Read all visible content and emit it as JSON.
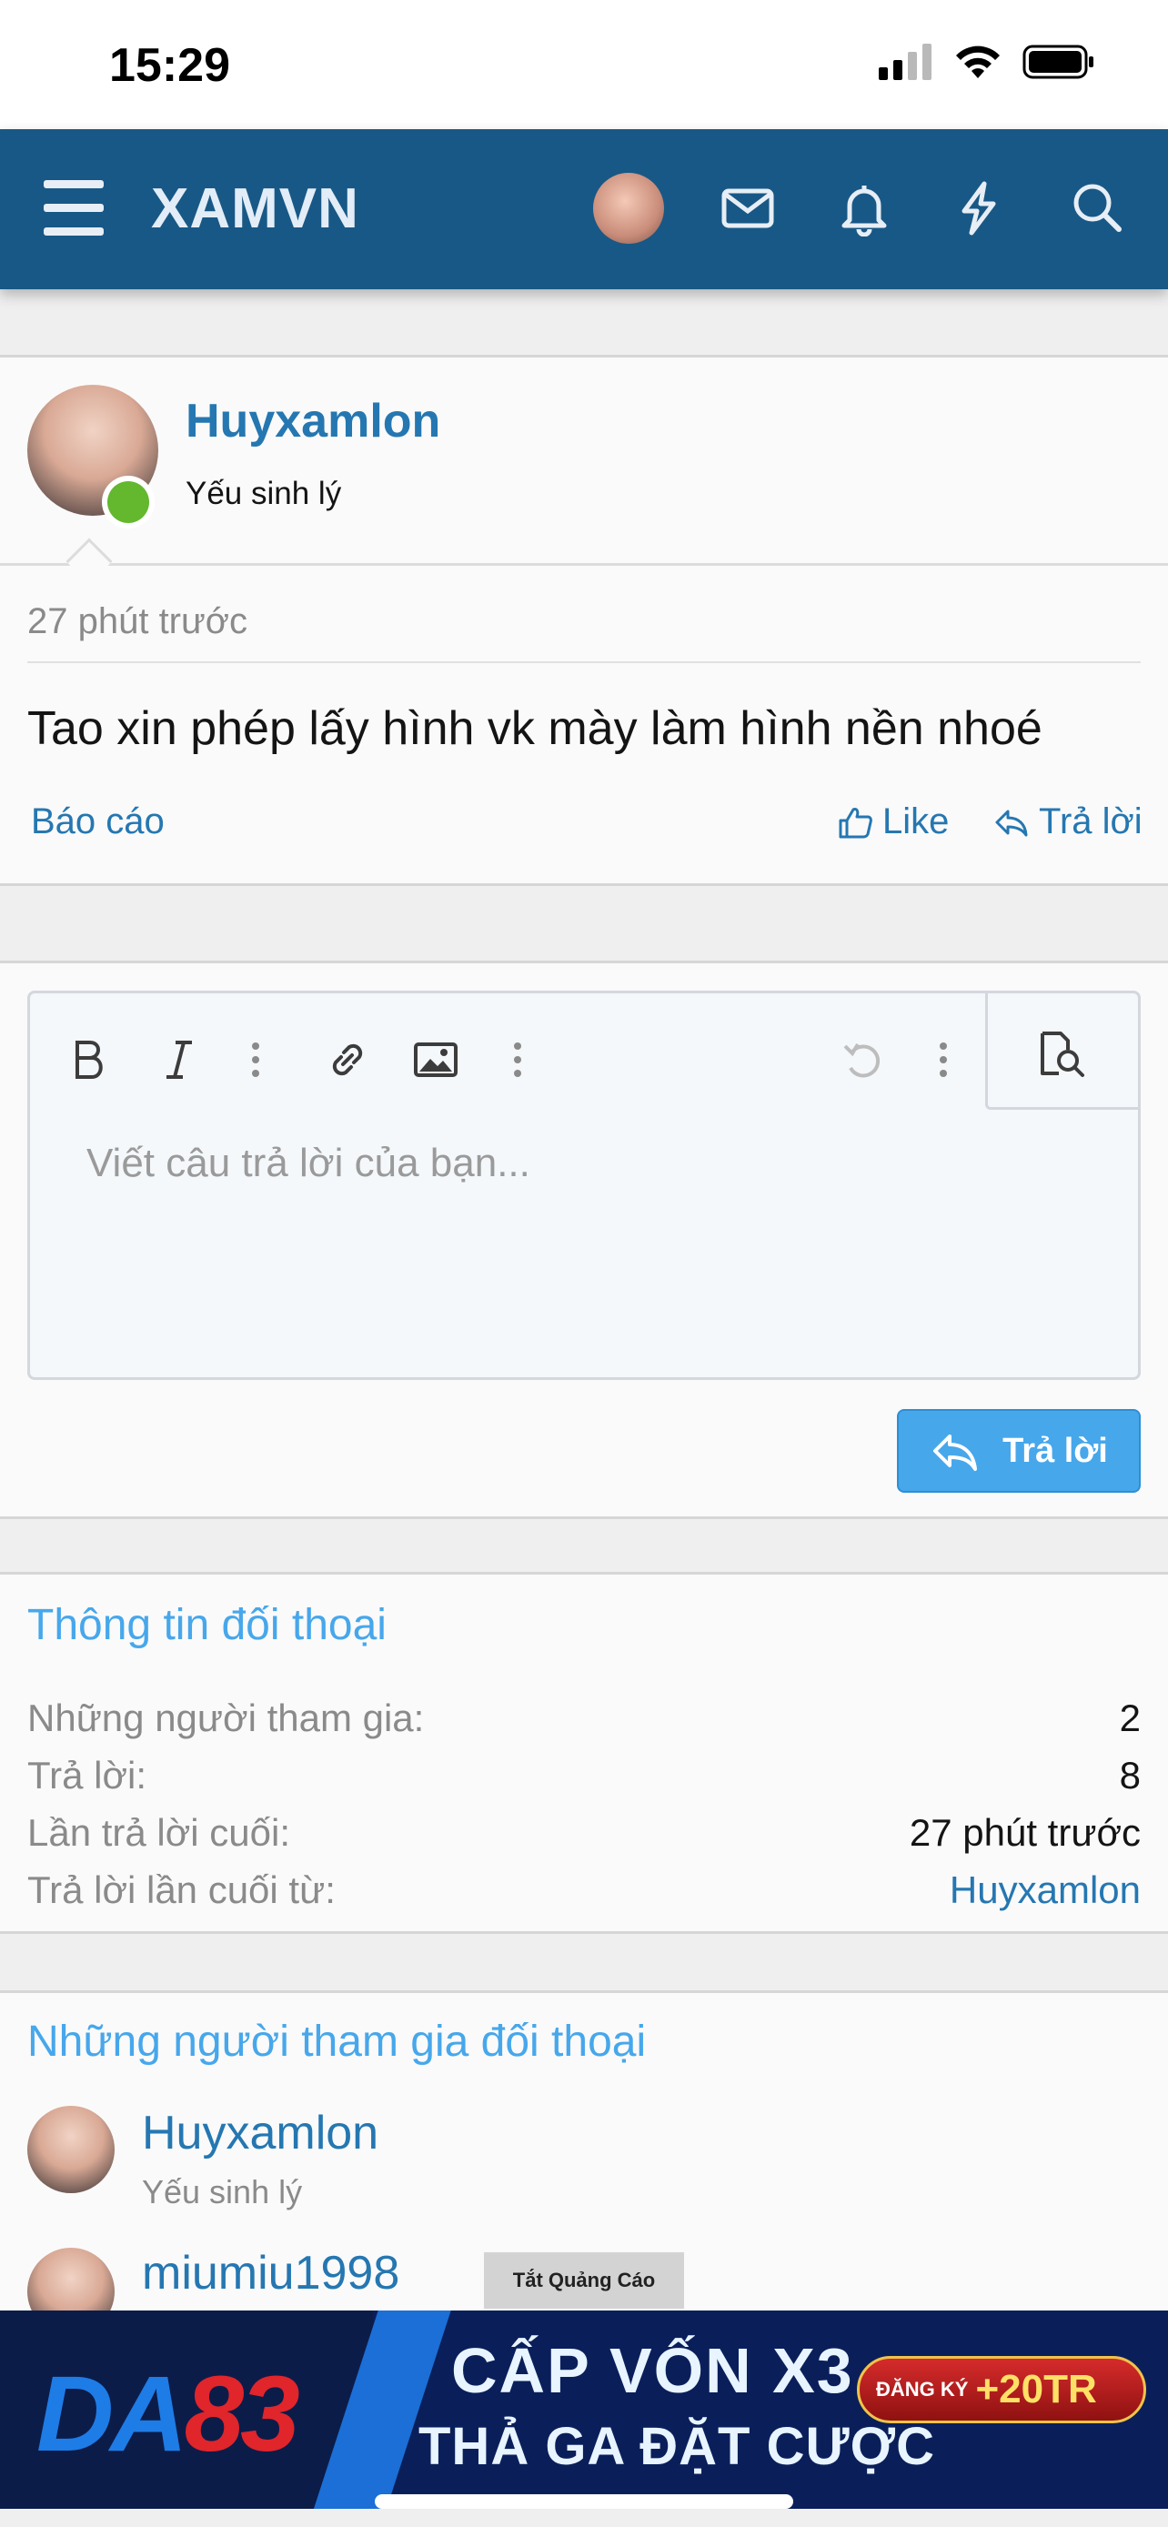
{
  "status_bar": {
    "time": "15:29"
  },
  "nav": {
    "logo": "XAMVN"
  },
  "message": {
    "author": "Huyxamlon",
    "author_title": "Yếu sinh lý",
    "time": "27 phút trước",
    "text": "Tao xin phép lấy hình vk mày làm hình nền nhoé",
    "report_label": "Báo cáo",
    "like_label": "Like",
    "reply_label": "Trả lời"
  },
  "editor": {
    "placeholder": "Viết câu trả lời của bạn...",
    "submit_label": "Trả lời"
  },
  "conversation_info": {
    "title": "Thông tin đối thoại",
    "rows": [
      {
        "label": "Những người tham gia:",
        "value": "2"
      },
      {
        "label": "Trả lời:",
        "value": "8"
      },
      {
        "label": "Lần trả lời cuối:",
        "value": "27 phút trước"
      },
      {
        "label": "Trả lời lần cuối từ:",
        "value": "Huyxamlon"
      }
    ]
  },
  "participants": {
    "title": "Những người tham gia đối thoại",
    "items": [
      {
        "name": "Huyxamlon",
        "title": "Yếu sinh lý"
      },
      {
        "name": "miumiu1998"
      }
    ]
  },
  "ad": {
    "close_label": "Tắt Quảng Cáo",
    "brand_a": "DA",
    "brand_b": "83",
    "line1": "CẤP VỐN X3",
    "line2": "THẢ GA ĐẶT CƯỢC",
    "cta_small": "ĐĂNG KÝ",
    "cta_big": "+20TR"
  }
}
